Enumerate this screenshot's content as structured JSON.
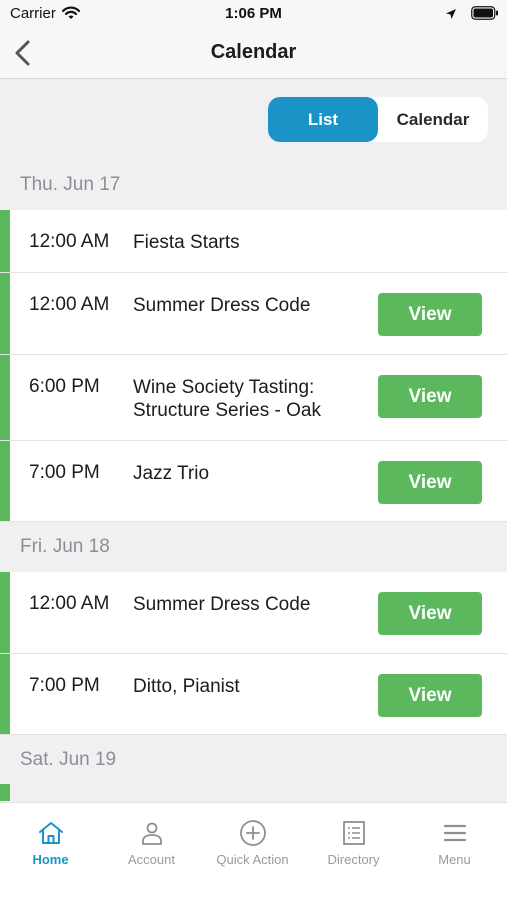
{
  "status_bar": {
    "carrier": "Carrier",
    "time": "1:06 PM"
  },
  "nav": {
    "title": "Calendar"
  },
  "segmented": {
    "list_label": "List",
    "calendar_label": "Calendar",
    "selected": "List"
  },
  "days": [
    {
      "label": "Thu. Jun 17",
      "events": [
        {
          "time": "12:00 AM",
          "title": "Fiesta Starts",
          "has_view": false
        },
        {
          "time": "12:00 AM",
          "title": "Summer Dress Code",
          "has_view": true,
          "view_label": "View"
        },
        {
          "time": "6:00 PM",
          "title": "Wine Society Tasting: Structure Series - Oak",
          "has_view": true,
          "view_label": "View"
        },
        {
          "time": "7:00 PM",
          "title": "Jazz Trio",
          "has_view": true,
          "view_label": "View"
        }
      ]
    },
    {
      "label": "Fri. Jun 18",
      "events": [
        {
          "time": "12:00 AM",
          "title": "Summer Dress Code",
          "has_view": true,
          "view_label": "View"
        },
        {
          "time": "7:00 PM",
          "title": "Ditto, Pianist",
          "has_view": true,
          "view_label": "View"
        }
      ]
    },
    {
      "label": "Sat. Jun 19",
      "events": []
    }
  ],
  "tab_bar": {
    "items": [
      {
        "label": "Home",
        "icon": "home-icon",
        "active": true
      },
      {
        "label": "Account",
        "icon": "person-icon",
        "active": false
      },
      {
        "label": "Quick Action",
        "icon": "plus-circle-icon",
        "active": false
      },
      {
        "label": "Directory",
        "icon": "list-document-icon",
        "active": false
      },
      {
        "label": "Menu",
        "icon": "hamburger-menu-icon",
        "active": false
      }
    ]
  },
  "colors": {
    "accent": "#1a94c7",
    "event_bar": "#5cb85c",
    "view_button": "#5cb85c",
    "background": "#f0f0f2",
    "day_header_text": "#8e8e93"
  }
}
